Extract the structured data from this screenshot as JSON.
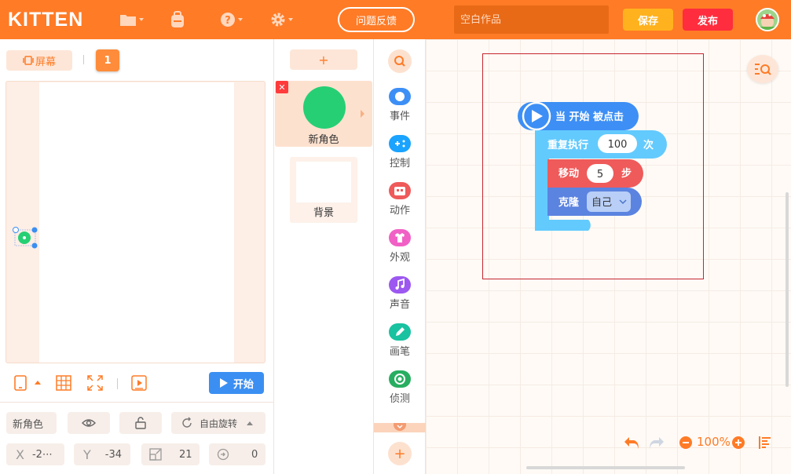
{
  "app": {
    "logo": "KITTEN"
  },
  "topbar": {
    "feedback_label": "问题反馈",
    "title_placeholder": "空白作品",
    "save_label": "保存",
    "publish_label": "发布"
  },
  "stage_panel": {
    "screen_tab_label": "屏幕",
    "scene_number": "1",
    "start_label": "开始"
  },
  "props": {
    "name": "新角色",
    "rotation_label": "自由旋转",
    "x_label": "X",
    "x_value": "-2⋯",
    "y_label": "Y",
    "y_value": "-34",
    "size_value": "21",
    "direction_value": "0"
  },
  "sprites_panel": {
    "add_label": "+",
    "sprite_name": "新角色",
    "background_name": "背景"
  },
  "categories": [
    {
      "label": "事件",
      "color": "#3d8ff5"
    },
    {
      "label": "控制",
      "color": "#1aa3ff"
    },
    {
      "label": "动作",
      "color": "#ef5a5a"
    },
    {
      "label": "外观",
      "color": "#f160c5"
    },
    {
      "label": "声音",
      "color": "#9c58f0"
    },
    {
      "label": "画笔",
      "color": "#19c2a0"
    },
    {
      "label": "侦测",
      "color": "#28ae61"
    }
  ],
  "add_category_label": "+",
  "blocks": {
    "hat_text": "当 开始 被点击",
    "repeat_label": "重复执行",
    "repeat_value": "100",
    "repeat_suffix": "次",
    "move_label": "移动",
    "move_value": "5",
    "move_suffix": "步",
    "clone_label": "克隆",
    "clone_value": "自己"
  },
  "workspace": {
    "zoom": "100%"
  }
}
